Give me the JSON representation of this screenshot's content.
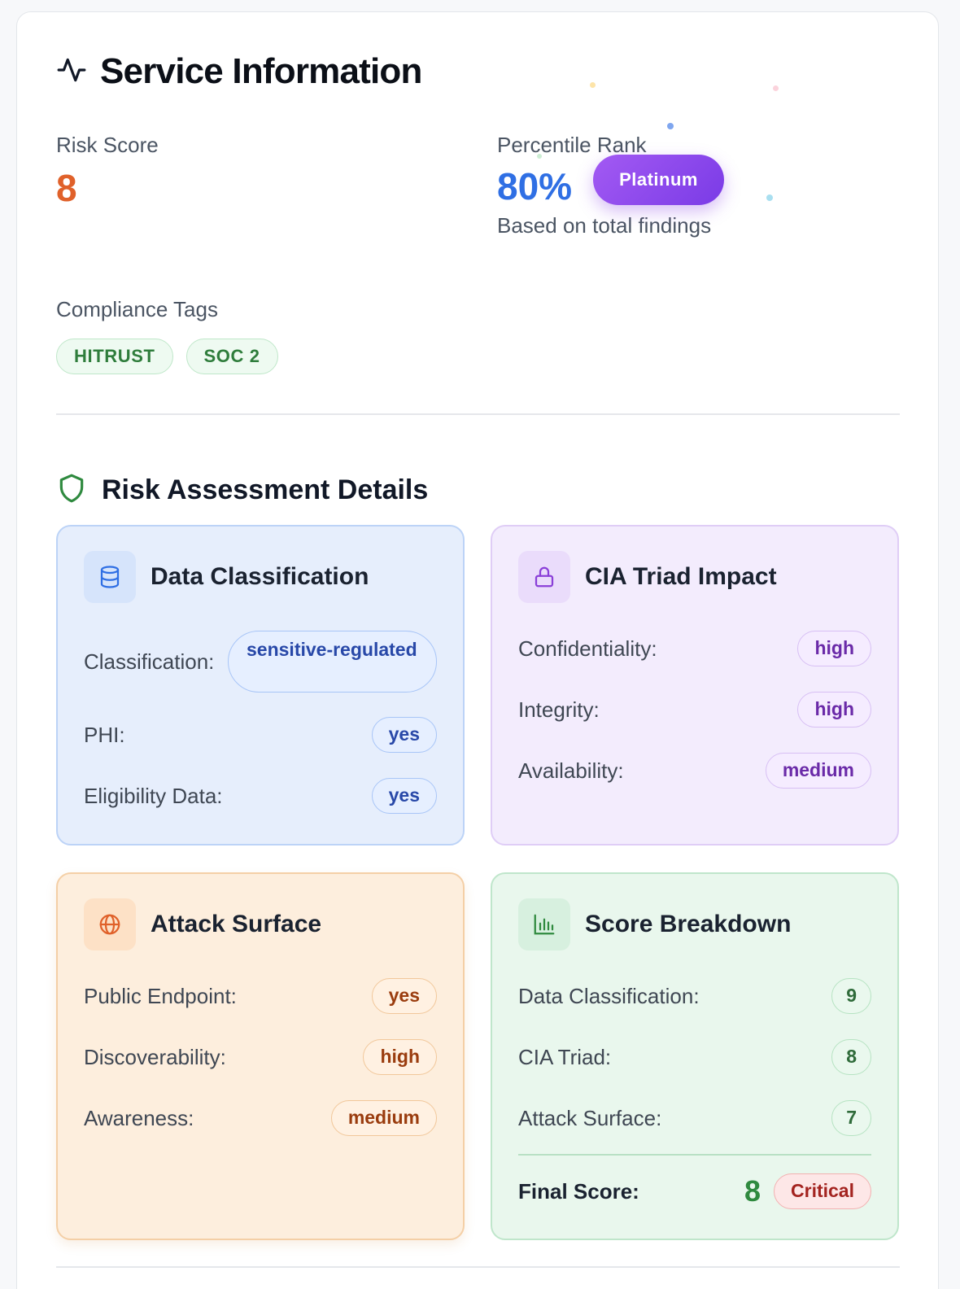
{
  "header": {
    "title": "Service Information",
    "icon": "activity-icon"
  },
  "risk": {
    "label": "Risk Score",
    "value": "8",
    "color": "#e0612a"
  },
  "percentile": {
    "label": "Percentile Rank",
    "value": "80%",
    "badge": "Platinum",
    "subtext": "Based on total findings",
    "color": "#2f6fe4"
  },
  "compliance": {
    "label": "Compliance Tags",
    "tags": [
      "HITRUST",
      "SOC 2"
    ]
  },
  "assessment": {
    "title": "Risk Assessment Details",
    "icon": "shield-icon",
    "data_classification": {
      "title": "Data Classification",
      "icon": "database-icon",
      "rows": [
        {
          "label": "Classification:",
          "value": "sensitive-regulated"
        },
        {
          "label": "PHI:",
          "value": "yes"
        },
        {
          "label": "Eligibility Data:",
          "value": "yes"
        }
      ]
    },
    "cia": {
      "title": "CIA Triad Impact",
      "icon": "lock-icon",
      "rows": [
        {
          "label": "Confidentiality:",
          "value": "high"
        },
        {
          "label": "Integrity:",
          "value": "high"
        },
        {
          "label": "Availability:",
          "value": "medium"
        }
      ]
    },
    "attack_surface": {
      "title": "Attack Surface",
      "icon": "globe-icon",
      "rows": [
        {
          "label": "Public Endpoint:",
          "value": "yes"
        },
        {
          "label": "Discoverability:",
          "value": "high"
        },
        {
          "label": "Awareness:",
          "value": "medium"
        }
      ]
    },
    "score_breakdown": {
      "title": "Score Breakdown",
      "icon": "bar-chart-icon",
      "rows": [
        {
          "label": "Data Classification:",
          "value": "9"
        },
        {
          "label": "CIA Triad:",
          "value": "8"
        },
        {
          "label": "Attack Surface:",
          "value": "7"
        }
      ],
      "final_label": "Final Score:",
      "final_value": "8",
      "final_severity": "Critical"
    }
  },
  "colors": {
    "blue_panel": "#e6eefc",
    "purple_panel": "#f3ecfd",
    "orange_panel": "#fdeedd",
    "green_panel": "#e9f7ed",
    "accent_green": "#2f8a3f"
  }
}
